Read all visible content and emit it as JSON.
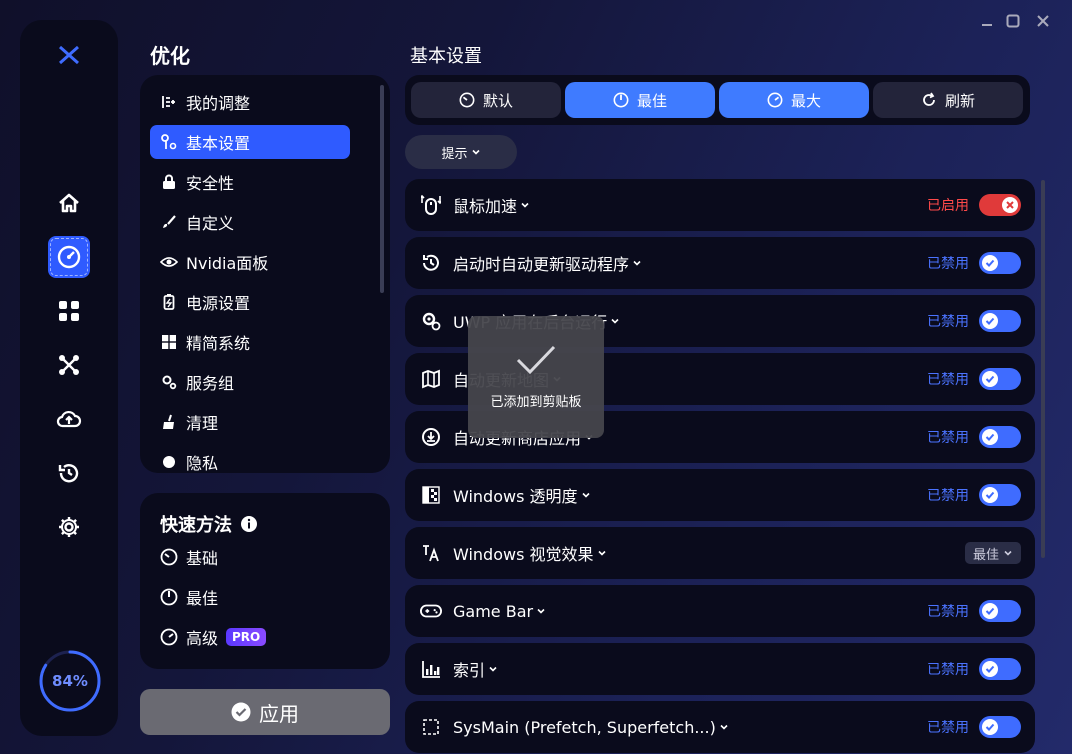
{
  "window": {
    "controls": [
      "minimize",
      "maximize",
      "close"
    ]
  },
  "rail": {
    "items": [
      {
        "icon": "logo-x-icon"
      },
      {
        "icon": "home-icon"
      },
      {
        "icon": "speedometer-icon",
        "active": true
      },
      {
        "icon": "apps-grid-icon"
      },
      {
        "icon": "network-icon"
      },
      {
        "icon": "cloud-upload-icon"
      },
      {
        "icon": "history-icon"
      },
      {
        "icon": "gear-icon"
      }
    ],
    "progress": {
      "label": "84%",
      "value": 0.84
    }
  },
  "sidebar": {
    "title": "优化",
    "items": [
      {
        "label": "我的调整",
        "icon": "list-plus-icon"
      },
      {
        "label": "基本设置",
        "icon": "tools-icon",
        "active": true
      },
      {
        "label": "安全性",
        "icon": "lock-icon"
      },
      {
        "label": "自定义",
        "icon": "brush-icon"
      },
      {
        "label": "Nvidia面板",
        "icon": "nvidia-eye-icon"
      },
      {
        "label": "电源设置",
        "icon": "battery-icon"
      },
      {
        "label": "精简系统",
        "icon": "windows-logo-icon"
      },
      {
        "label": "服务组",
        "icon": "gears-icon"
      },
      {
        "label": "清理",
        "icon": "broom-icon"
      },
      {
        "label": "隐私",
        "icon": "privacy-icon"
      }
    ]
  },
  "quick": {
    "title": "快速方法",
    "items": [
      {
        "label": "基础",
        "icon": "gauge-low-icon"
      },
      {
        "label": "最佳",
        "icon": "gauge-mid-icon"
      },
      {
        "label": "高级",
        "icon": "gauge-high-icon",
        "badge": "PRO"
      }
    ]
  },
  "apply": {
    "label": "应用"
  },
  "main": {
    "title": "基本设置",
    "presets": [
      {
        "label": "默认",
        "icon": "gauge-low-icon",
        "selected": false
      },
      {
        "label": "最佳",
        "icon": "gauge-mid-icon",
        "selected": true
      },
      {
        "label": "最大",
        "icon": "gauge-high-icon",
        "selected": true
      },
      {
        "label": "刷新",
        "icon": "refresh-icon",
        "selected": false
      }
    ],
    "hint": {
      "label": "提示"
    },
    "rows": [
      {
        "label": "鼠标加速",
        "icon": "mouse-icon",
        "status": "已启用",
        "control": "toggle-red"
      },
      {
        "label": "启动时自动更新驱动程序",
        "icon": "clock-refresh-icon",
        "status": "已禁用",
        "control": "toggle"
      },
      {
        "label": "UWP 应用在后台运行",
        "icon": "gear-refresh-icon",
        "status": "已禁用",
        "control": "toggle"
      },
      {
        "label": "自动更新地图",
        "icon": "map-icon",
        "status": "已禁用",
        "control": "toggle"
      },
      {
        "label": "自动更新商店应用",
        "icon": "download-icon",
        "status": "已禁用",
        "control": "toggle"
      },
      {
        "label": "Windows 透明度",
        "icon": "transparency-icon",
        "status": "已禁用",
        "control": "toggle"
      },
      {
        "label": "Windows 视觉效果",
        "icon": "font-a-icon",
        "status": "最佳",
        "control": "select"
      },
      {
        "label": "Game Bar",
        "icon": "gamepad-icon",
        "status": "已禁用",
        "control": "toggle"
      },
      {
        "label": "索引",
        "icon": "bar-chart-icon",
        "status": "已禁用",
        "control": "toggle"
      },
      {
        "label": "SysMain (Prefetch, Superfetch...)",
        "icon": "sysmain-icon",
        "status": "已禁用",
        "control": "toggle"
      }
    ]
  },
  "toast": {
    "text": "已添加到剪贴板",
    "icon": "check-icon"
  }
}
